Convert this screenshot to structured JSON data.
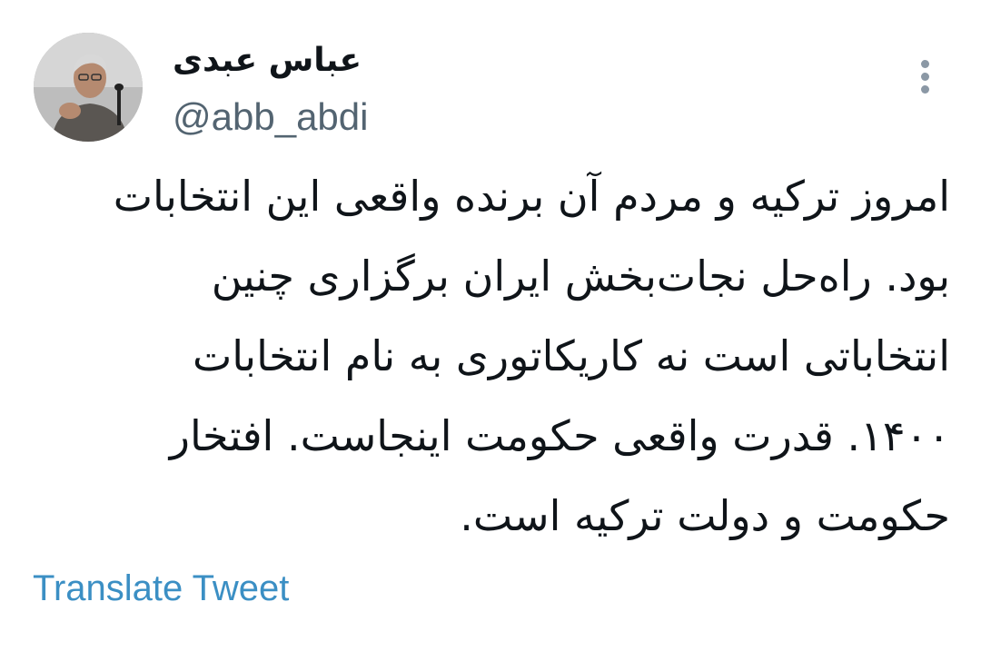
{
  "author": {
    "display_name": "عباس عبدی",
    "handle": "@abb_abdi",
    "avatar_icon": "profile-photo"
  },
  "menu": {
    "icon": "more-vertical-icon"
  },
  "tweet": {
    "text": "امروز ترکیه و مردم آن برنده واقعی این انتخابات\nبود. راه‌حل نجات‌بخش ایران برگزاری چنین\nانتخاباتی است نه کاریکاتوری به نام انتخابات\n۱۴۰۰. قدرت واقعی حکومت اینجاست. افتخار\nحکومت و دولت ترکیه است."
  },
  "actions": {
    "translate_label": "Translate Tweet"
  },
  "colors": {
    "text": "#0f1419",
    "secondary": "#536471",
    "link": "#3b8fc4",
    "icon": "#8b98a5"
  }
}
